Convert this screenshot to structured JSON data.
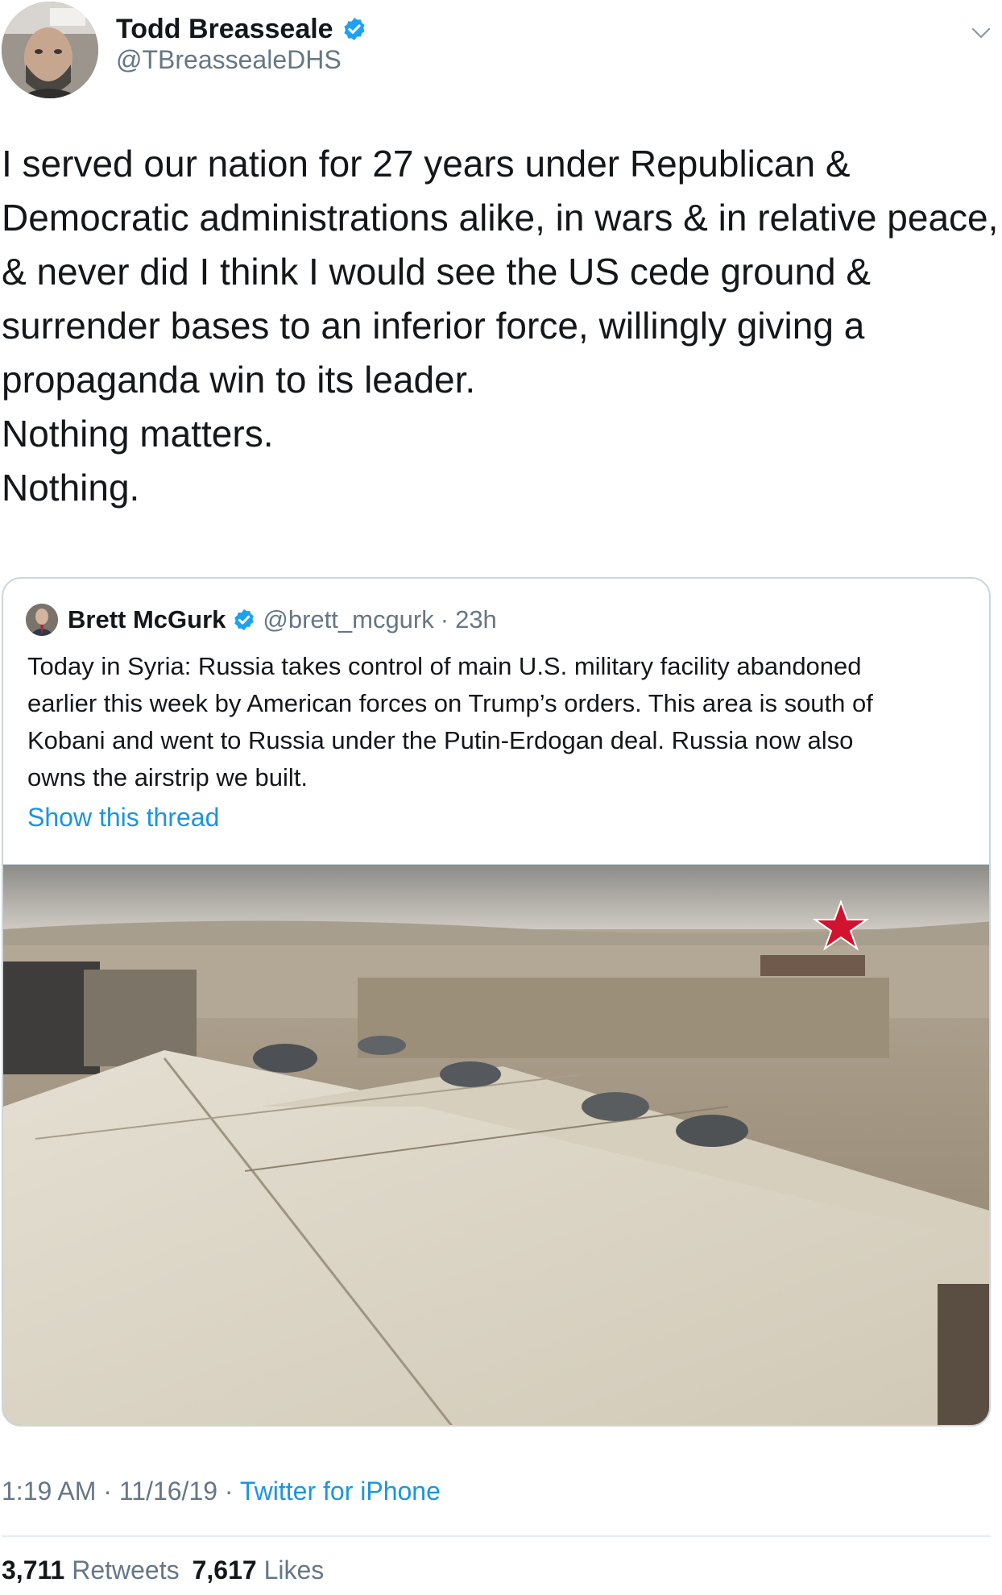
{
  "tweet": {
    "author": {
      "name": "Todd Breasseale",
      "handle": "@TBreassealeDHS",
      "verified": true
    },
    "text_lines": [
      "I served our nation for 27 years under Republican &",
      "Democratic administrations alike, in wars & in relative peace,",
      "& never did I think I would see the US cede ground &",
      "surrender bases to an inferior force, willingly giving a",
      "propaganda win to its leader.",
      "Nothing matters.",
      "Nothing."
    ],
    "time": "1:19 AM",
    "date": "11/16/19",
    "separator": "·",
    "source": "Twitter for iPhone",
    "retweets_count": "3,711",
    "retweets_label": "Retweets",
    "likes_count": "7,617",
    "likes_label": "Likes"
  },
  "quote": {
    "author": {
      "name": "Brett McGurk",
      "handle": "@brett_mcgurk",
      "verified": true
    },
    "separator": "·",
    "time": "23h",
    "text_lines": [
      "Today in Syria: Russia takes control of main U.S. military facility abandoned",
      "earlier this week by American forces on Trump’s orders. This area is south of",
      "Kobani and went to Russia under the Putin-Erdogan deal. Russia now also",
      "owns the airstrip we built."
    ],
    "show_thread_label": "Show this thread"
  },
  "colors": {
    "text_primary": "#14171a",
    "text_secondary": "#657786",
    "link": "#1b95e0",
    "verified": "#1da1f2",
    "border": "#ccd6dd"
  },
  "icons": {
    "verified": "verified-badge-icon",
    "caret": "chevron-down-icon"
  }
}
